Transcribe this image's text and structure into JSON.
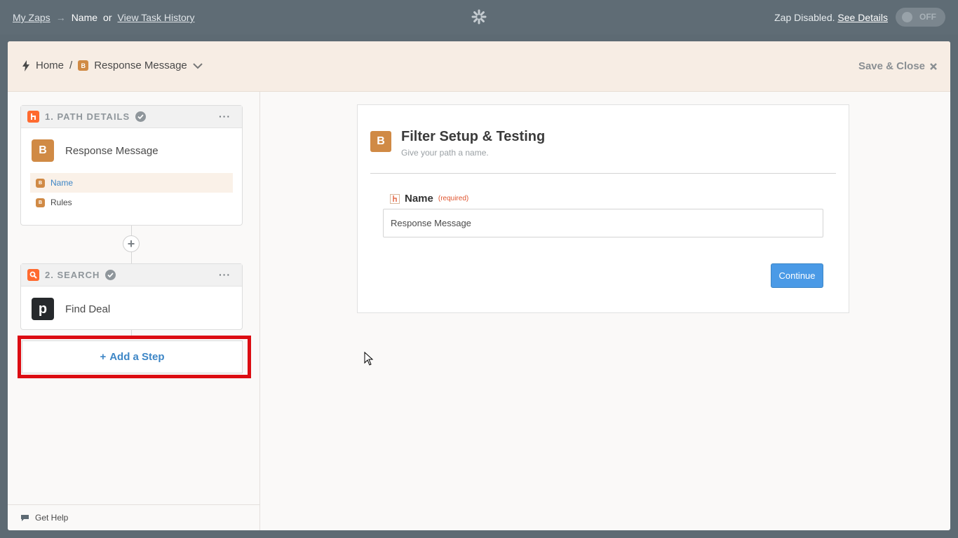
{
  "topbar": {
    "my_zaps": "My Zaps",
    "arrow": "→",
    "name": "Name",
    "or": "or",
    "view_history": "View Task History",
    "status_text": "Zap Disabled.",
    "see_details": "See Details",
    "toggle_label": "OFF"
  },
  "header": {
    "home": "Home",
    "separator": "/",
    "path_badge": "B",
    "path_name": "Response Message",
    "save_close": "Save & Close"
  },
  "sidebar": {
    "step1": {
      "heading": "1. PATH DETAILS",
      "menu": "···",
      "badge": "B",
      "title": "Response Message",
      "items": [
        {
          "badge": "B",
          "label": "Name",
          "active": true
        },
        {
          "badge": "B",
          "label": "Rules",
          "active": false
        }
      ]
    },
    "step2": {
      "heading": "2. SEARCH",
      "menu": "···",
      "app_letter": "p",
      "title": "Find Deal"
    },
    "add_step": "Add a Step",
    "add_step_plus": "+",
    "get_help": "Get Help"
  },
  "card": {
    "badge": "B",
    "title": "Filter Setup & Testing",
    "subtitle": "Give your path a name.",
    "field_label": "Name",
    "field_required": "(required)",
    "field_value": "Response Message",
    "continue": "Continue"
  },
  "colors": {
    "accent_orange": "#d08a45",
    "link_blue": "#3d86c6",
    "button_blue": "#4a9ae6",
    "highlight_red": "#dc0c12"
  }
}
